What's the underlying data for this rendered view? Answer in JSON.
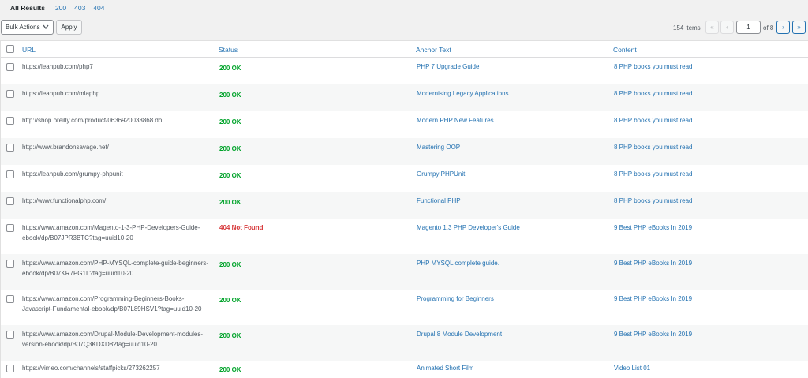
{
  "filters": {
    "current": "All Results",
    "links": [
      "200",
      "403",
      "404"
    ]
  },
  "toolbar": {
    "bulk_actions": "Bulk Actions",
    "apply": "Apply"
  },
  "pagination": {
    "items_count": "154 items",
    "first": "«",
    "prev": "‹",
    "current_page": "1",
    "of_pages": "of 8",
    "next": "›",
    "last": "»"
  },
  "columns": {
    "url": "URL",
    "status": "Status",
    "anchor": "Anchor Text",
    "content": "Content"
  },
  "rows": [
    {
      "url": "https://leanpub.com/php7",
      "status": "200 OK",
      "anchor": "PHP 7 Upgrade Guide",
      "content": "8 PHP books you must read"
    },
    {
      "url": "https://leanpub.com/mlaphp",
      "status": "200 OK",
      "anchor": "Modernising Legacy Applications",
      "content": "8 PHP books you must read"
    },
    {
      "url": "http://shop.oreilly.com/product/0636920033868.do",
      "status": "200 OK",
      "anchor": "Modern PHP New Features",
      "content": "8 PHP books you must read"
    },
    {
      "url": "http://www.brandonsavage.net/",
      "status": "200 OK",
      "anchor": "Mastering OOP",
      "content": "8 PHP books you must read"
    },
    {
      "url": "https://leanpub.com/grumpy-phpunit",
      "status": "200 OK",
      "anchor": "Grumpy PHPUnit",
      "content": "8 PHP books you must read"
    },
    {
      "url": "http://www.functionalphp.com/",
      "status": "200 OK",
      "anchor": "Functional PHP",
      "content": "8 PHP books you must read"
    },
    {
      "url": "https://www.amazon.com/Magento-1-3-PHP-Developers-Guide-ebook/dp/B07JPR3BTC?tag=uuid10-20",
      "status": "404 Not Found",
      "anchor": "Magento 1.3 PHP Developer's Guide",
      "content": "9 Best PHP eBooks In 2019"
    },
    {
      "url": "https://www.amazon.com/PHP-MYSQL-complete-guide-beginners-ebook/dp/B07KR7PG1L?tag=uuid10-20",
      "status": "200 OK",
      "anchor": "PHP MYSQL complete guide.",
      "content": "9 Best PHP eBooks In 2019"
    },
    {
      "url": "https://www.amazon.com/Programming-Beginners-Books-Javascript-Fundamental-ebook/dp/B07L89HSV1?tag=uuid10-20",
      "status": "200 OK",
      "anchor": "Programming for Beginners",
      "content": "9 Best PHP eBooks In 2019"
    },
    {
      "url": "https://www.amazon.com/Drupal-Module-Development-modules-version-ebook/dp/B07Q3KDXD8?tag=uuid10-20",
      "status": "200 OK",
      "anchor": "Drupal 8 Module Development",
      "content": "9 Best PHP eBooks In 2019"
    },
    {
      "url": "https://vimeo.com/channels/staffpicks/273262257",
      "status": "200 OK",
      "anchor": "Animated Short Film",
      "content": "Video List 01"
    }
  ],
  "colors": {
    "link": "#2271b1",
    "ok": "#00a32a",
    "error": "#d63638"
  }
}
